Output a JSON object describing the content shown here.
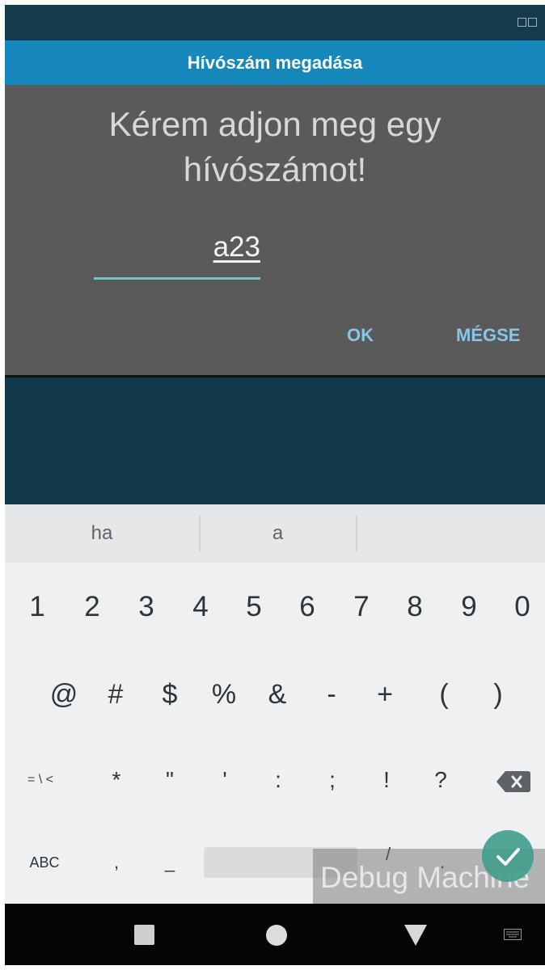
{
  "dialog": {
    "title": "Hívószám megadása",
    "message": "Kérem adjon meg egy hívószámot!",
    "input_value": "a23",
    "ok_label": "OK",
    "cancel_label": "MÉGSE"
  },
  "keyboard": {
    "suggestions": [
      "ha",
      "a",
      ""
    ],
    "row1": [
      "1",
      "2",
      "3",
      "4",
      "5",
      "6",
      "7",
      "8",
      "9",
      "0"
    ],
    "row2": [
      "@",
      "#",
      "$",
      "%",
      "&",
      "-",
      "+",
      "(",
      ")"
    ],
    "row3": [
      "= \\ <",
      "*",
      "\"",
      "'",
      ":",
      ";",
      "!",
      "?"
    ],
    "row4": {
      "abc_label": "ABC",
      "comma": ",",
      "underscore": "_",
      "slash": "/",
      "period": "."
    }
  },
  "watermark": "Debug Machine",
  "icons": {
    "status": [
      "status-window-icon",
      "status-window-icon"
    ],
    "keyboard": [
      "backspace-icon",
      "enter-check-icon"
    ],
    "navbar": [
      "recent-apps-icon",
      "home-icon",
      "back-icon",
      "keyboard-switch-icon"
    ]
  },
  "colors": {
    "dialog_title_bg": "#1587ba",
    "dialog_bg": "#5a5a5a",
    "accent": "#74c3c6",
    "button_text": "#86c7e6"
  }
}
